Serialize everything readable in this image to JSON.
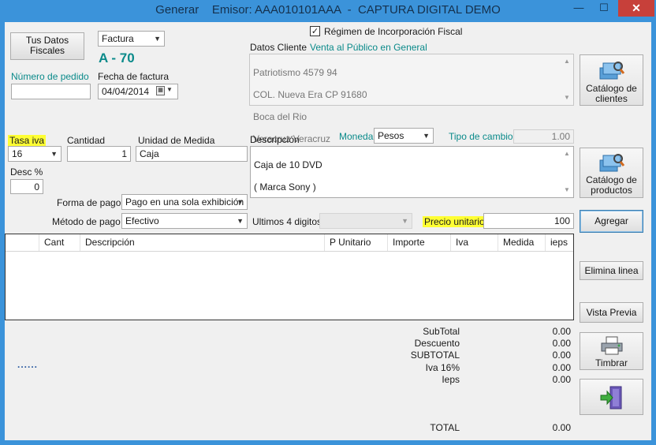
{
  "window": {
    "title": "Generar    Emisor: AAA010101AAA  -  CAPTURA DIGITAL DEMO",
    "minimize": "—",
    "maximize": "☐",
    "close": "✕"
  },
  "header": {
    "tus_datos_fiscales": "Tus Datos Fiscales",
    "doc_type": "Factura",
    "folio": "A - 70",
    "numero_pedido_label": "Número de pedido",
    "numero_pedido_value": "",
    "fecha_label": "Fecha de factura",
    "fecha_value": "04/04/2014",
    "regimen_label": "Régimen de Incorporación Fiscal",
    "regimen_checked": "✓"
  },
  "cliente": {
    "label": "Datos Cliente",
    "name": "Venta al Público en General",
    "address_lines": [
      "Patriotismo 4579 94",
      "COL. Nueva Era   CP 91680",
      "Boca del Rio",
      "Veracruz   Veracruz"
    ],
    "catalogo_clientes": "Catálogo de clientes"
  },
  "item": {
    "tasa_iva_label": "Tasa iva",
    "tasa_iva_value": "16",
    "cantidad_label": "Cantidad",
    "cantidad_value": "1",
    "unidad_label": "Unidad de Medida",
    "unidad_value": "Caja",
    "desc_pct_label": "Desc %",
    "desc_pct_value": "0",
    "descripcion_label": "Descripción",
    "descripcion_lines": [
      "Caja de 10 DVD",
      "( Marca Sony )"
    ],
    "moneda_label": "Moneda",
    "moneda_value": "Pesos",
    "tipo_cambio_label": "Tipo de cambio",
    "tipo_cambio_value": "1.00",
    "catalogo_productos": "Catálogo de productos",
    "forma_pago_label": "Forma de pago",
    "forma_pago_value": "Pago en una sola exhibición",
    "metodo_pago_label": "Método de pago",
    "metodo_pago_value": "Efectivo",
    "ultimos_label": "Ultimos 4 digitos",
    "ultimos_value": "",
    "precio_label": "Precio unitario",
    "precio_value": "100",
    "agregar": "Agregar"
  },
  "grid": {
    "columns": [
      "",
      "Cant",
      "Descripción",
      "P Unitario",
      "Importe",
      "Iva",
      "Medida",
      "ieps"
    ]
  },
  "side_buttons": {
    "elimina": "Elimina linea",
    "vista": "Vista Previa",
    "timbrar": "Timbrar"
  },
  "totals": {
    "dots": "......",
    "rows": [
      {
        "label": "SubTotal",
        "value": "0.00"
      },
      {
        "label": "Descuento",
        "value": "0.00"
      },
      {
        "label": "SUBTOTAL",
        "value": "0.00"
      },
      {
        "label": "Iva 16%",
        "value": "0.00"
      },
      {
        "label": "Ieps",
        "value": "0.00"
      }
    ],
    "total_label": "TOTAL",
    "total_value": "0.00"
  },
  "colors": {
    "titlebar": "#3b93da",
    "close": "#c7403a",
    "teal": "#0a8a8a",
    "highlight": "#ffff33"
  }
}
